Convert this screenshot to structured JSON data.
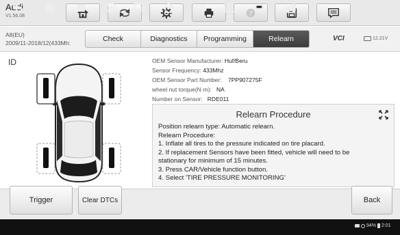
{
  "app": {
    "brand": "Audi",
    "version": "V1.56.08"
  },
  "toolbar": {
    "icons": [
      "home-icon",
      "vehicle-swap-icon",
      "gear-icon",
      "printer-icon",
      "help-icon",
      "save-icon",
      "message-icon"
    ]
  },
  "vehicle": {
    "model": "A8(EU)",
    "years": "2009/11-2018/12(433Mh:"
  },
  "tabs": [
    {
      "label": "Check",
      "active": false
    },
    {
      "label": "Diagnostics",
      "active": false
    },
    {
      "label": "Programming",
      "active": false
    },
    {
      "label": "Relearn",
      "active": true
    }
  ],
  "vci": {
    "label": "VCI",
    "voltage": "12.21V"
  },
  "id_label": "ID",
  "sensor": {
    "manufacturer_label": "OEM Sensor Manufacturer:",
    "manufacturer_value": "Huf/Beru",
    "frequency_label": "Sensor Frequency:",
    "frequency_value": "433Mhz",
    "part_label": "OEM Sensor Part Number:",
    "part_value": "7PP907275F",
    "torque_label": "wheel nut torque(N·m):",
    "torque_value": "NA",
    "number_label": "Number on Sensor:",
    "number_value": "RDE011"
  },
  "relearn": {
    "title": "Relearn Procedure",
    "lines": [
      "Position relearn type: Automatic relearn.",
      "Relearn Procedure:",
      "1. Inflate all tires to the pressure indicated on tire placard.",
      "2. If replacement Sensors have been fitted, vehicle will need to be",
      "stationary for minimum of 15 minutes.",
      "3. Press CAR/Vehicle function button.",
      "4. Select 'TIRE PRESSURE MONITORING'"
    ]
  },
  "buttons": {
    "trigger": "Trigger",
    "clear_dtcs": "Clear DTCs",
    "back": "Back"
  },
  "navbar": {
    "vci_label": "VCI"
  },
  "status_bar": {
    "battery": "94%",
    "time": "2:01"
  },
  "colors": {
    "active_tab": "#464646",
    "selected_tire_frame": "#555555",
    "nav_bg": "#111111"
  }
}
